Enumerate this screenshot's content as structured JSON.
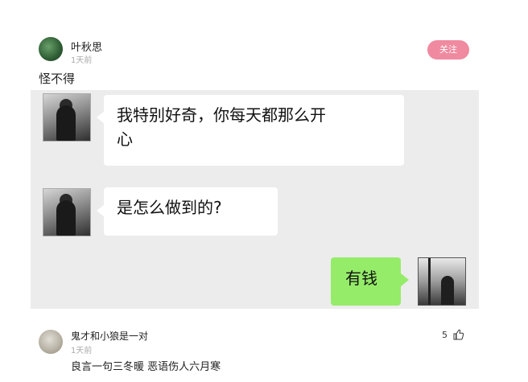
{
  "post": {
    "username": "叶秋思",
    "time": "1天前",
    "follow_label": "关注",
    "caption": "怪不得"
  },
  "chat": {
    "messages": [
      {
        "side": "left",
        "text_line1": "我特别好奇，你每天都那么开",
        "text_line2": "心"
      },
      {
        "side": "left",
        "text": "是怎么做到的?"
      },
      {
        "side": "right",
        "text": "有钱"
      }
    ]
  },
  "comment": {
    "username": "鬼才和小狼是一对",
    "time": "1天前",
    "likes": "5",
    "text": "良言一句三冬暖 恶语伤人六月寒"
  }
}
